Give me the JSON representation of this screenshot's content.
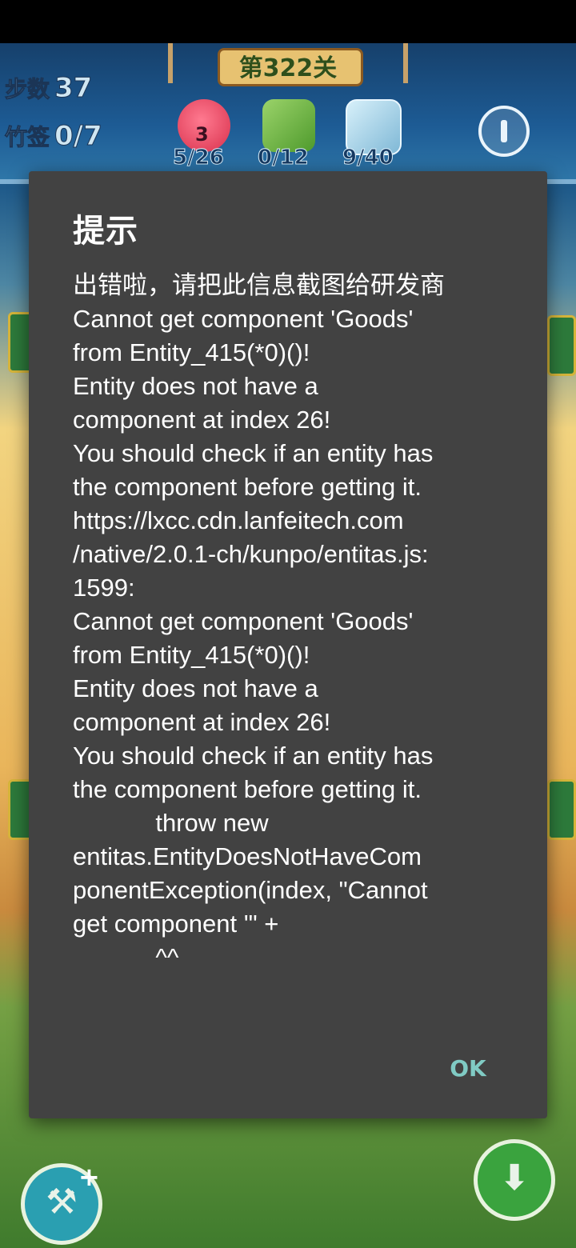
{
  "game": {
    "level_title": "第322关",
    "steps_label": "步数",
    "steps_value": "37",
    "bamboo_label": "竹签",
    "bamboo_value": "0/7",
    "goals": [
      {
        "icon": "red-blob-icon",
        "badge": "3",
        "count": "5/26"
      },
      {
        "icon": "green-block-icon",
        "count": "0/12"
      },
      {
        "icon": "ice-block-icon",
        "count": "9/40"
      }
    ],
    "colors": {
      "hud": "#1d5b94",
      "dialog_bg": "#424242",
      "ok_text": "#80cbc4"
    }
  },
  "dialog": {
    "title": "提示",
    "message": "出错啦，请把此信息截图给研发商\nCannot get component 'Goods'\nfrom Entity_415(*0)()!\nEntity does not have a\ncomponent at index 26!\nYou should check if an entity has\nthe component before getting it.\nhttps://lxcc.cdn.lanfeitech.com\n/native/2.0.1-ch/kunpo/entitas.js:\n1599:\nCannot get component 'Goods'\nfrom Entity_415(*0)()!\nEntity does not have a\ncomponent at index 26!\nYou should check if an entity has\nthe component before getting it.\n            throw new\nentitas.EntityDoesNotHaveCom\nponentException(index, \"Cannot\nget component '\" +\n            ^^",
    "ok_label": "OK"
  }
}
